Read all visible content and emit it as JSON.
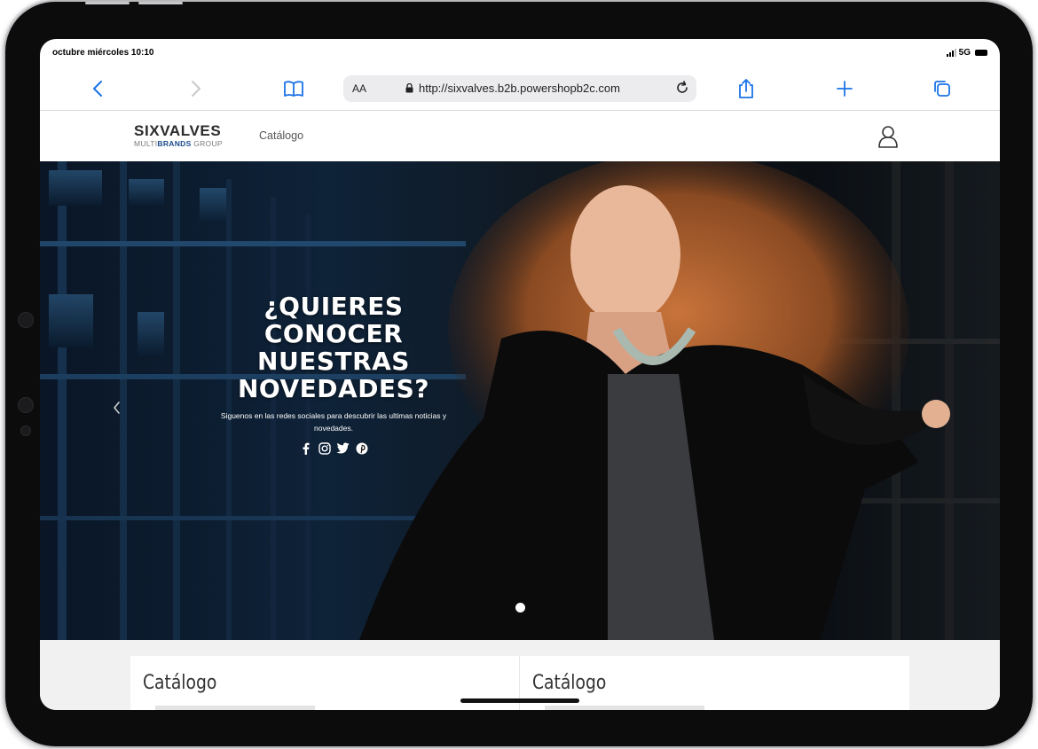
{
  "status": {
    "time": "octubre miércoles 10:10",
    "network": "5G"
  },
  "browser": {
    "aa": "AA",
    "url": "http://sixvalves.b2b.powershopb2c.com",
    "icons": [
      "back-icon",
      "forward-icon",
      "bookmarks-icon",
      "lock-icon",
      "reload-icon",
      "share-icon",
      "new-tab-icon",
      "tabs-icon"
    ]
  },
  "header": {
    "logo_main": "SIXVALVES",
    "logo_sub_1": "MULTI",
    "logo_sub_2": "BRANDS",
    "logo_sub_3": " GROUP",
    "nav_catalog": "Catálogo"
  },
  "hero": {
    "title_line1": "¿QUIERES CONOCER",
    "title_line2": "NUESTRAS",
    "title_line3": "NOVEDADES?",
    "subtitle": "Siguenos en las redes sociales para descubrir las ultimas noticias y novedades.",
    "socials": [
      "facebook-icon",
      "instagram-icon",
      "twitter-icon",
      "pinterest-icon"
    ]
  },
  "cards": [
    {
      "title": "Catálogo"
    },
    {
      "title": "Catálogo"
    }
  ],
  "colors": {
    "accent": "#1a73e8",
    "brand_blue": "#1c4a8e"
  }
}
